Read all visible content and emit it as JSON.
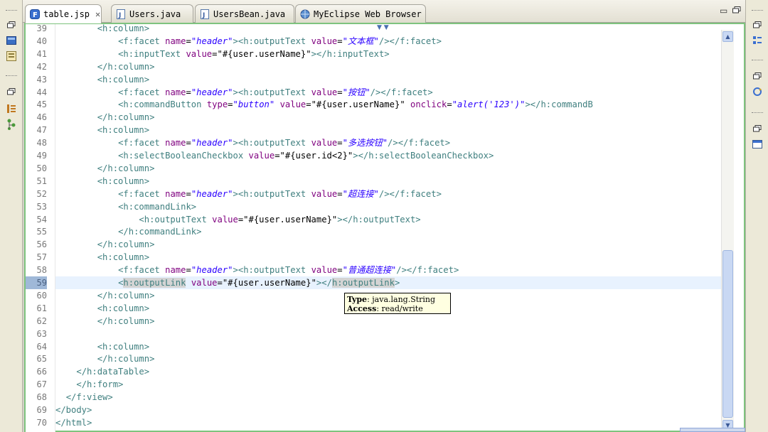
{
  "tabs": [
    {
      "label": "table.jsp",
      "icon": "jsp-file-icon",
      "active": true
    },
    {
      "label": "Users.java",
      "icon": "java-file-icon",
      "active": false
    },
    {
      "label": "UsersBean.java",
      "icon": "java-file-icon",
      "active": false
    },
    {
      "label": "MyEclipse Web Browser",
      "icon": "globe-icon",
      "active": false
    }
  ],
  "gutter": {
    "line_numbers": [
      "39",
      "40",
      "41",
      "42",
      "43",
      "44",
      "45",
      "46",
      "47",
      "48",
      "49",
      "50",
      "51",
      "52",
      "53",
      "54",
      "55",
      "56",
      "57",
      "58",
      "59",
      "60",
      "61",
      "62",
      "63",
      "64",
      "65",
      "66",
      "67",
      "68",
      "69",
      "70"
    ],
    "current_line": "59"
  },
  "code": [
    {
      "n": "39",
      "segs": [
        [
          "p",
          "        "
        ],
        [
          "t",
          "<h:column>"
        ]
      ]
    },
    {
      "n": "40",
      "segs": [
        [
          "p",
          "            "
        ],
        [
          "t",
          "<f:facet "
        ],
        [
          "a",
          "name"
        ],
        [
          "p",
          "="
        ],
        [
          "s",
          "\"header\""
        ],
        [
          "t",
          "><h:outputText "
        ],
        [
          "a",
          "value"
        ],
        [
          "p",
          "="
        ],
        [
          "s",
          "\"文本框\""
        ],
        [
          "t",
          "/></f:facet>"
        ]
      ]
    },
    {
      "n": "41",
      "segs": [
        [
          "p",
          "            "
        ],
        [
          "t",
          "<h:inputText "
        ],
        [
          "a",
          "value"
        ],
        [
          "p",
          "=\"#{user.userName}\""
        ],
        [
          "t",
          "></h:inputText>"
        ]
      ]
    },
    {
      "n": "42",
      "segs": [
        [
          "p",
          "        "
        ],
        [
          "t",
          "</h:column>"
        ]
      ]
    },
    {
      "n": "43",
      "segs": [
        [
          "p",
          "        "
        ],
        [
          "t",
          "<h:column>"
        ]
      ]
    },
    {
      "n": "44",
      "segs": [
        [
          "p",
          "            "
        ],
        [
          "t",
          "<f:facet "
        ],
        [
          "a",
          "name"
        ],
        [
          "p",
          "="
        ],
        [
          "s",
          "\"header\""
        ],
        [
          "t",
          "><h:outputText "
        ],
        [
          "a",
          "value"
        ],
        [
          "p",
          "="
        ],
        [
          "s",
          "\"按钮\""
        ],
        [
          "t",
          "/></f:facet>"
        ]
      ]
    },
    {
      "n": "45",
      "segs": [
        [
          "p",
          "            "
        ],
        [
          "t",
          "<h:commandButton "
        ],
        [
          "a",
          "type"
        ],
        [
          "p",
          "="
        ],
        [
          "s",
          "\"button\""
        ],
        [
          "p",
          " "
        ],
        [
          "a",
          "value"
        ],
        [
          "p",
          "=\"#{user.userName}\" "
        ],
        [
          "a",
          "onclick"
        ],
        [
          "p",
          "="
        ],
        [
          "s",
          "\"alert('123')\""
        ],
        [
          "t",
          "></h:commandB"
        ]
      ]
    },
    {
      "n": "46",
      "segs": [
        [
          "p",
          "        "
        ],
        [
          "t",
          "</h:column>"
        ]
      ]
    },
    {
      "n": "47",
      "segs": [
        [
          "p",
          "        "
        ],
        [
          "t",
          "<h:column>"
        ]
      ]
    },
    {
      "n": "48",
      "segs": [
        [
          "p",
          "            "
        ],
        [
          "t",
          "<f:facet "
        ],
        [
          "a",
          "name"
        ],
        [
          "p",
          "="
        ],
        [
          "s",
          "\"header\""
        ],
        [
          "t",
          "><h:outputText "
        ],
        [
          "a",
          "value"
        ],
        [
          "p",
          "="
        ],
        [
          "s",
          "\"多选按钮\""
        ],
        [
          "t",
          "/></f:facet>"
        ]
      ]
    },
    {
      "n": "49",
      "segs": [
        [
          "p",
          "            "
        ],
        [
          "t",
          "<h:selectBooleanCheckbox "
        ],
        [
          "a",
          "value"
        ],
        [
          "p",
          "=\"#{user.id<2}\""
        ],
        [
          "t",
          "></h:selectBooleanCheckbox>"
        ]
      ]
    },
    {
      "n": "50",
      "segs": [
        [
          "p",
          "        "
        ],
        [
          "t",
          "</h:column>"
        ]
      ]
    },
    {
      "n": "51",
      "segs": [
        [
          "p",
          "        "
        ],
        [
          "t",
          "<h:column>"
        ]
      ]
    },
    {
      "n": "52",
      "segs": [
        [
          "p",
          "            "
        ],
        [
          "t",
          "<f:facet "
        ],
        [
          "a",
          "name"
        ],
        [
          "p",
          "="
        ],
        [
          "s",
          "\"header\""
        ],
        [
          "t",
          "><h:outputText "
        ],
        [
          "a",
          "value"
        ],
        [
          "p",
          "="
        ],
        [
          "s",
          "\"超连接\""
        ],
        [
          "t",
          "/></f:facet>"
        ]
      ]
    },
    {
      "n": "53",
      "segs": [
        [
          "p",
          "            "
        ],
        [
          "t",
          "<h:commandLink>"
        ]
      ]
    },
    {
      "n": "54",
      "segs": [
        [
          "p",
          "                "
        ],
        [
          "t",
          "<h:outputText "
        ],
        [
          "a",
          "value"
        ],
        [
          "p",
          "=\"#{user.userName}\""
        ],
        [
          "t",
          "></h:outputText>"
        ]
      ]
    },
    {
      "n": "55",
      "segs": [
        [
          "p",
          "            "
        ],
        [
          "t",
          "</h:commandLink>"
        ]
      ]
    },
    {
      "n": "56",
      "segs": [
        [
          "p",
          "        "
        ],
        [
          "t",
          "</h:column>"
        ]
      ]
    },
    {
      "n": "57",
      "segs": [
        [
          "p",
          "        "
        ],
        [
          "t",
          "<h:column>"
        ]
      ]
    },
    {
      "n": "58",
      "segs": [
        [
          "p",
          "            "
        ],
        [
          "t",
          "<f:facet "
        ],
        [
          "a",
          "name"
        ],
        [
          "p",
          "="
        ],
        [
          "s",
          "\"header\""
        ],
        [
          "t",
          "><h:outputText "
        ],
        [
          "a",
          "value"
        ],
        [
          "p",
          "="
        ],
        [
          "s",
          "\"普通超连接\""
        ],
        [
          "t",
          "/></f:facet>"
        ]
      ]
    },
    {
      "n": "59",
      "segs": [
        [
          "p",
          "            "
        ],
        [
          "t",
          "<"
        ],
        [
          "h",
          "h:outputLink"
        ],
        [
          "p",
          " "
        ],
        [
          "a",
          "value"
        ],
        [
          "p",
          "=\"#{user.userName}\""
        ],
        [
          "t",
          "></"
        ],
        [
          "h",
          "h:outputLink"
        ],
        [
          "t",
          ">"
        ]
      ]
    },
    {
      "n": "60",
      "segs": [
        [
          "p",
          "        "
        ],
        [
          "t",
          "</h:column>"
        ]
      ]
    },
    {
      "n": "61",
      "segs": [
        [
          "p",
          "        "
        ],
        [
          "t",
          "<h:column>"
        ]
      ]
    },
    {
      "n": "62",
      "segs": [
        [
          "p",
          "        "
        ],
        [
          "t",
          "</h:column>"
        ]
      ]
    },
    {
      "n": "63",
      "segs": [
        [
          "p",
          ""
        ]
      ]
    },
    {
      "n": "64",
      "segs": [
        [
          "p",
          "        "
        ],
        [
          "t",
          "<h:column>"
        ]
      ]
    },
    {
      "n": "65",
      "segs": [
        [
          "p",
          "        "
        ],
        [
          "t",
          "</h:column>"
        ]
      ]
    },
    {
      "n": "66",
      "segs": [
        [
          "p",
          "    "
        ],
        [
          "t",
          "</h:dataTable>"
        ]
      ]
    },
    {
      "n": "67",
      "segs": [
        [
          "p",
          "    "
        ],
        [
          "t",
          "</h:form>"
        ]
      ]
    },
    {
      "n": "68",
      "segs": [
        [
          "p",
          "  "
        ],
        [
          "t",
          "</f:view>"
        ]
      ]
    },
    {
      "n": "69",
      "segs": [
        [
          "t",
          "</body>"
        ]
      ]
    },
    {
      "n": "70",
      "segs": [
        [
          "t",
          "</html>"
        ]
      ]
    }
  ],
  "tooltip": {
    "type_label": "Type",
    "type_value": "java.lang.String",
    "access_label": "Access",
    "access_value": "read/write"
  },
  "colors": {
    "tag": "#3f7f7f",
    "attribute": "#7f007f",
    "string": "#2a00ff",
    "editor_border": "#7ec37e",
    "current_line": "#e8f2fe"
  }
}
